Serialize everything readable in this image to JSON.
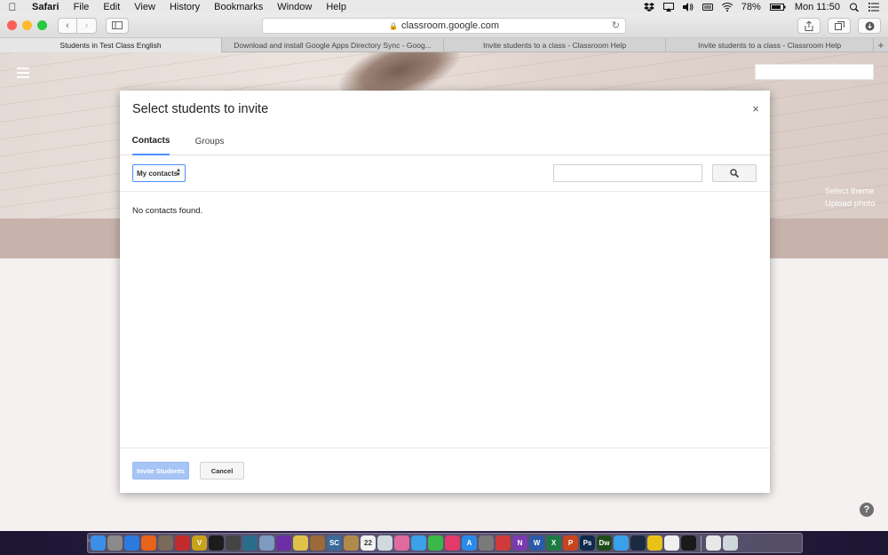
{
  "menubar": {
    "app_name": "Safari",
    "items": [
      "File",
      "Edit",
      "View",
      "History",
      "Bookmarks",
      "Window",
      "Help"
    ],
    "battery": "78%",
    "clock": "Mon 11:50"
  },
  "browser": {
    "url": "classroom.google.com",
    "tabs": [
      {
        "title": "Students in Test Class English"
      },
      {
        "title": "Download and install Google Apps Directory Sync - Goog..."
      },
      {
        "title": "Invite students to a class - Classroom Help"
      },
      {
        "title": "Invite students to a class - Classroom Help"
      }
    ],
    "new_tab": "+"
  },
  "classroom": {
    "theme_links": [
      "Select theme",
      "Upload photo"
    ],
    "help": "?"
  },
  "dialog": {
    "title": "Select students to invite",
    "close": "×",
    "tabs": [
      "Contacts",
      "Groups"
    ],
    "contacts_select": "My contacts",
    "empty_message": "No contacts found.",
    "invite_button": "Invite Students",
    "cancel_button": "Cancel"
  },
  "dock": {
    "apps": [
      {
        "name": "finder-icon",
        "color": "#3d8ee6",
        "glyph": ""
      },
      {
        "name": "launchpad-icon",
        "color": "#8a8a8a",
        "glyph": ""
      },
      {
        "name": "safari-icon",
        "color": "#2c7ae0",
        "glyph": ""
      },
      {
        "name": "firefox-icon",
        "color": "#e8631c",
        "glyph": ""
      },
      {
        "name": "app-icon",
        "color": "#7a6a5a",
        "glyph": ""
      },
      {
        "name": "app-icon",
        "color": "#c22b2b",
        "glyph": ""
      },
      {
        "name": "app-icon",
        "color": "#c8a21a",
        "glyph": "V"
      },
      {
        "name": "app-icon",
        "color": "#1c1c1c",
        "glyph": ""
      },
      {
        "name": "app-icon",
        "color": "#444444",
        "glyph": ""
      },
      {
        "name": "app-icon",
        "color": "#2a6d8a",
        "glyph": ""
      },
      {
        "name": "app-icon",
        "color": "#7d9ac0",
        "glyph": ""
      },
      {
        "name": "app-icon",
        "color": "#6b2fa3",
        "glyph": ""
      },
      {
        "name": "app-icon",
        "color": "#e0c24a",
        "glyph": ""
      },
      {
        "name": "app-icon",
        "color": "#9a6a3a",
        "glyph": ""
      },
      {
        "name": "app-icon",
        "color": "#3a6a9a",
        "glyph": "SC"
      },
      {
        "name": "app-icon",
        "color": "#b08a4a",
        "glyph": ""
      },
      {
        "name": "calendar-icon",
        "color": "#f2f2f2",
        "glyph": "22"
      },
      {
        "name": "app-icon",
        "color": "#d0d8e0",
        "glyph": ""
      },
      {
        "name": "photos-icon",
        "color": "#e06aa0",
        "glyph": ""
      },
      {
        "name": "messages-icon",
        "color": "#3aa0e8",
        "glyph": ""
      },
      {
        "name": "facetime-icon",
        "color": "#3ab84a",
        "glyph": ""
      },
      {
        "name": "itunes-icon",
        "color": "#e23a6a",
        "glyph": ""
      },
      {
        "name": "app-store-icon",
        "color": "#2a8ae8",
        "glyph": "A"
      },
      {
        "name": "system-prefs-icon",
        "color": "#7a7a7a",
        "glyph": ""
      },
      {
        "name": "app-icon",
        "color": "#d03a3a",
        "glyph": ""
      },
      {
        "name": "onenote-icon",
        "color": "#7a3ab0",
        "glyph": "N"
      },
      {
        "name": "word-icon",
        "color": "#2a5aaa",
        "glyph": "W"
      },
      {
        "name": "excel-icon",
        "color": "#1e7a45",
        "glyph": "X"
      },
      {
        "name": "powerpoint-icon",
        "color": "#c8451e",
        "glyph": "P"
      },
      {
        "name": "photoshop-icon",
        "color": "#0f2a4a",
        "glyph": "Ps"
      },
      {
        "name": "dreamweaver-icon",
        "color": "#1f4a1a",
        "glyph": "Dw"
      },
      {
        "name": "twitter-icon",
        "color": "#3aa0e8",
        "glyph": ""
      },
      {
        "name": "steam-icon",
        "color": "#1a2a40",
        "glyph": ""
      },
      {
        "name": "app-icon",
        "color": "#e8c21a",
        "glyph": ""
      },
      {
        "name": "app-icon",
        "color": "#f0f0f0",
        "glyph": ""
      },
      {
        "name": "terminal-icon",
        "color": "#1a1a1a",
        "glyph": ""
      },
      {
        "name": "app-icon",
        "color": "#e8e8e8",
        "glyph": ""
      },
      {
        "name": "trash-icon",
        "color": "#cfd6dc",
        "glyph": ""
      }
    ]
  }
}
